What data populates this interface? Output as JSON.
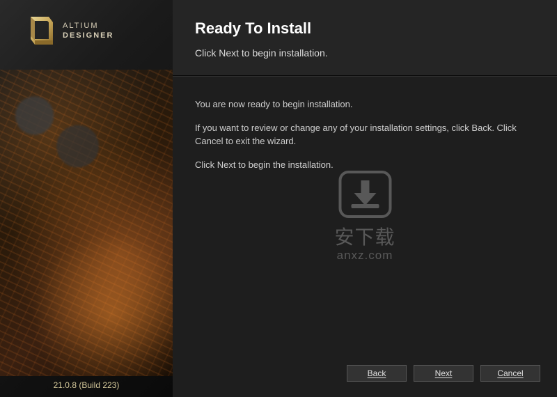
{
  "brand": {
    "line1": "ALTIUM",
    "line2": "DESIGNER"
  },
  "version": "21.0.8 (Build 223)",
  "header": {
    "title": "Ready To Install",
    "subtitle": "Click Next to begin installation."
  },
  "body": {
    "line1": "You are now ready to begin installation.",
    "line2": "If you want to review or change any of your installation settings, click Back. Click Cancel to exit the wizard.",
    "line3": "Click Next to begin the installation."
  },
  "buttons": {
    "back": "Back",
    "next": "Next",
    "cancel": "Cancel"
  },
  "watermark": {
    "text": "安下载",
    "url": "anxz.com"
  }
}
